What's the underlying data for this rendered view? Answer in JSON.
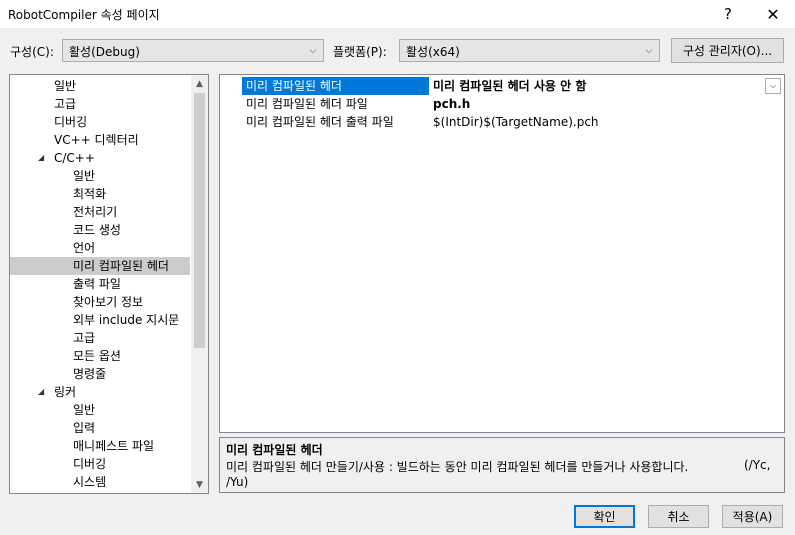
{
  "window": {
    "title": "RobotCompiler 속성 페이지",
    "help_glyph": "?",
    "close_glyph": "✕"
  },
  "config": {
    "config_label": "구성(C):",
    "config_value": "활성(Debug)",
    "platform_label": "플랫폼(P):",
    "platform_value": "활성(x64)",
    "manager_button": "구성 관리자(O)..."
  },
  "tree": {
    "items": [
      {
        "label": "일반",
        "level": 1
      },
      {
        "label": "고급",
        "level": 1
      },
      {
        "label": "디버깅",
        "level": 1
      },
      {
        "label": "VC++ 디렉터리",
        "level": 1
      },
      {
        "label": "C/C++",
        "level": 1,
        "expanded": true
      },
      {
        "label": "일반",
        "level": 2
      },
      {
        "label": "최적화",
        "level": 2
      },
      {
        "label": "전처리기",
        "level": 2
      },
      {
        "label": "코드 생성",
        "level": 2
      },
      {
        "label": "언어",
        "level": 2
      },
      {
        "label": "미리 컴파일된 헤더",
        "level": 2,
        "selected": true
      },
      {
        "label": "출력 파일",
        "level": 2
      },
      {
        "label": "찾아보기 정보",
        "level": 2
      },
      {
        "label": "외부 include 지시문",
        "level": 2
      },
      {
        "label": "고급",
        "level": 2
      },
      {
        "label": "모든 옵션",
        "level": 2
      },
      {
        "label": "명령줄",
        "level": 2
      },
      {
        "label": "링커",
        "level": 1,
        "expanded": true
      },
      {
        "label": "일반",
        "level": 2
      },
      {
        "label": "입력",
        "level": 2
      },
      {
        "label": "매니페스트 파일",
        "level": 2
      },
      {
        "label": "디버깅",
        "level": 2
      },
      {
        "label": "시스템",
        "level": 2
      }
    ]
  },
  "properties": [
    {
      "name": "미리 컴파일된 헤더",
      "value": "미리 컴파일된 헤더 사용 안 함",
      "bold": true,
      "selected": true
    },
    {
      "name": "미리 컴파일된 헤더 파일",
      "value": "pch.h",
      "bold": true,
      "selected": false
    },
    {
      "name": "미리 컴파일된 헤더 출력 파일",
      "value": "$(IntDir)$(TargetName).pch",
      "bold": false,
      "selected": false
    }
  ],
  "description": {
    "title": "미리 컴파일된 헤더",
    "text": "미리 컴파일된 헤더 만들기/사용 : 빌드하는 동안 미리 컴파일된 헤더를 만들거나 사용합니다.",
    "switch_1": "(/Yc,",
    "switch_2": "/Yu)"
  },
  "buttons": {
    "ok": "확인",
    "cancel": "취소",
    "apply": "적용(A)"
  },
  "colors": {
    "selection_blue": "#0078d7",
    "tree_selected": "#cccccc"
  }
}
